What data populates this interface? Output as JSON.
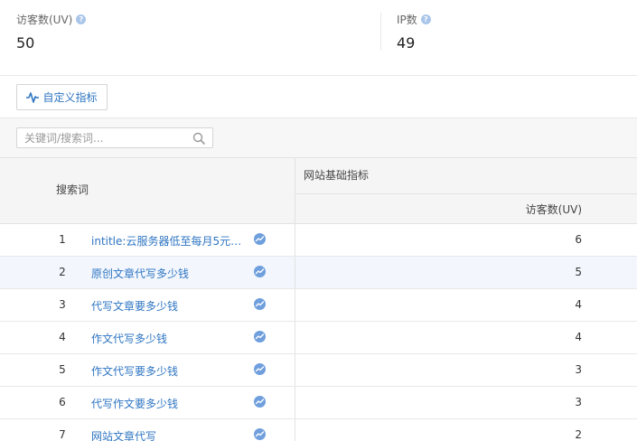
{
  "stats": [
    {
      "label": "访客数(UV)",
      "value": "50"
    },
    {
      "label": "IP数",
      "value": "49"
    }
  ],
  "help_glyph": "?",
  "toolbar": {
    "custom_metric_label": "自定义指标"
  },
  "filter": {
    "search_placeholder": "关键词/搜索词..."
  },
  "table": {
    "keyword_header": "搜索词",
    "group_header": "网站基础指标",
    "uv_header": "访客数(UV)",
    "rows": [
      {
        "index": "1",
        "keyword": "intitle:云服务器低至每月5元起 ...",
        "uv": "6"
      },
      {
        "index": "2",
        "keyword": "原创文章代写多少钱",
        "uv": "5"
      },
      {
        "index": "3",
        "keyword": "代写文章要多少钱",
        "uv": "4"
      },
      {
        "index": "4",
        "keyword": "作文代写多少钱",
        "uv": "4"
      },
      {
        "index": "5",
        "keyword": "作文代写要多少钱",
        "uv": "3"
      },
      {
        "index": "6",
        "keyword": "代写作文要多少钱",
        "uv": "3"
      },
      {
        "index": "7",
        "keyword": "网站文章代写",
        "uv": "2"
      }
    ]
  },
  "colors": {
    "link": "#2e75c2",
    "trend_icon": "#6f9fdc",
    "highlight_row": "#f3f7fd"
  },
  "icons": {
    "help": "question-circle-icon",
    "custom": "pulse-icon",
    "search": "search-icon",
    "trend": "trend-chart-icon"
  }
}
